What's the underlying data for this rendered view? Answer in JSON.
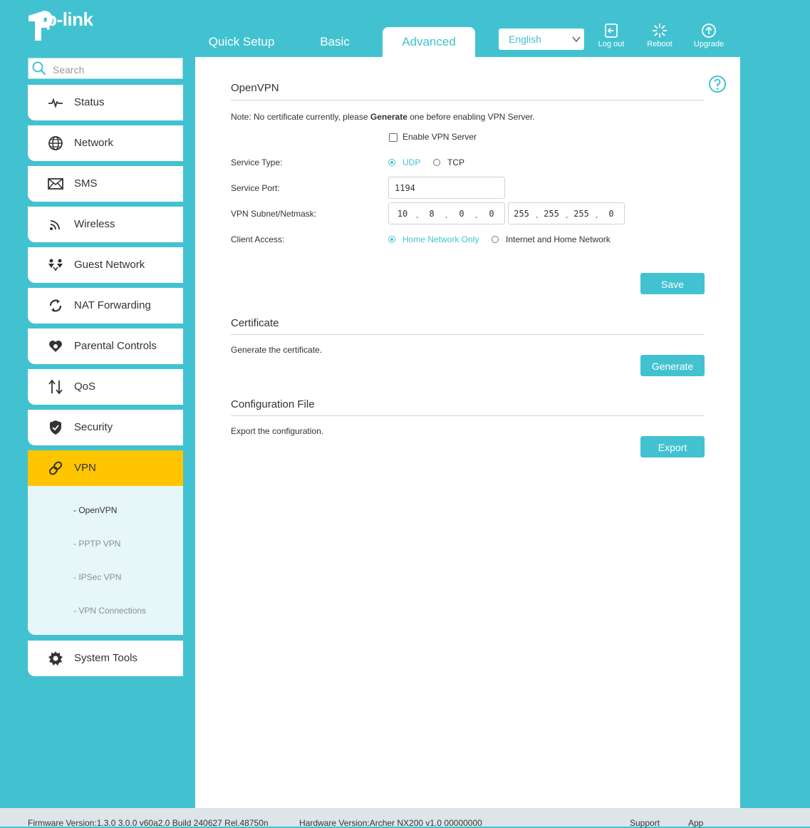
{
  "brand": {
    "logo_text": "tp-link"
  },
  "tabs": [
    {
      "label": "Quick Setup"
    },
    {
      "label": "Basic"
    },
    {
      "label": "Advanced"
    }
  ],
  "language": {
    "selected": "English"
  },
  "header_buttons": {
    "logout": "Log out",
    "reboot": "Reboot",
    "upgrade": "Upgrade"
  },
  "search": {
    "placeholder": "Search"
  },
  "nav": [
    {
      "label": "Status",
      "icon": "pulse-icon"
    },
    {
      "label": "Network",
      "icon": "globe-icon"
    },
    {
      "label": "SMS",
      "icon": "envelope-icon"
    },
    {
      "label": "Wireless",
      "icon": "wifi-icon"
    },
    {
      "label": "Guest Network",
      "icon": "guest-icon"
    },
    {
      "label": "NAT Forwarding",
      "icon": "nat-icon"
    },
    {
      "label": "Parental Controls",
      "icon": "heart-icon"
    },
    {
      "label": "QoS",
      "icon": "updown-arrows-icon"
    },
    {
      "label": "Security",
      "icon": "shield-icon"
    },
    {
      "label": "VPN",
      "icon": "link-icon"
    },
    {
      "label": "System Tools",
      "icon": "gear-icon"
    }
  ],
  "vpn_sub": [
    {
      "label": "- OpenVPN"
    },
    {
      "label": "- PPTP VPN"
    },
    {
      "label": "- IPSec VPN"
    },
    {
      "label": "- VPN Connections"
    }
  ],
  "openvpn": {
    "title": "OpenVPN",
    "note_prefix": "Note: No certificate currently, please ",
    "note_bold": "Generate",
    "note_suffix": " one before enabling VPN Server.",
    "enable_label": "Enable VPN Server",
    "service_type_label": "Service Type:",
    "udp": "UDP",
    "tcp": "TCP",
    "service_port_label": "Service Port:",
    "service_port": "1194",
    "subnet_label": "VPN Subnet/Netmask:",
    "subnet": [
      "10",
      "8",
      "0",
      "0"
    ],
    "netmask": [
      "255",
      "255",
      "255",
      "0"
    ],
    "client_access_label": "Client Access:",
    "home_only": "Home Network Only",
    "internet_home": "Internet and Home Network",
    "save": "Save"
  },
  "certificate": {
    "title": "Certificate",
    "text": "Generate the certificate.",
    "button": "Generate"
  },
  "config_file": {
    "title": "Configuration File",
    "text": "Export the configuration.",
    "button": "Export"
  },
  "footer": {
    "firmware": "Firmware Version:1.3.0 3.0.0 v60a2.0 Build 240627 Rel.48750n",
    "hardware": "Hardware Version:Archer NX200 v1.0 00000000",
    "support": "Support",
    "app": "App"
  },
  "colors": {
    "accent": "#42c2d0",
    "active_nav": "#ffc600",
    "sub_bg": "#e7f6f8"
  }
}
